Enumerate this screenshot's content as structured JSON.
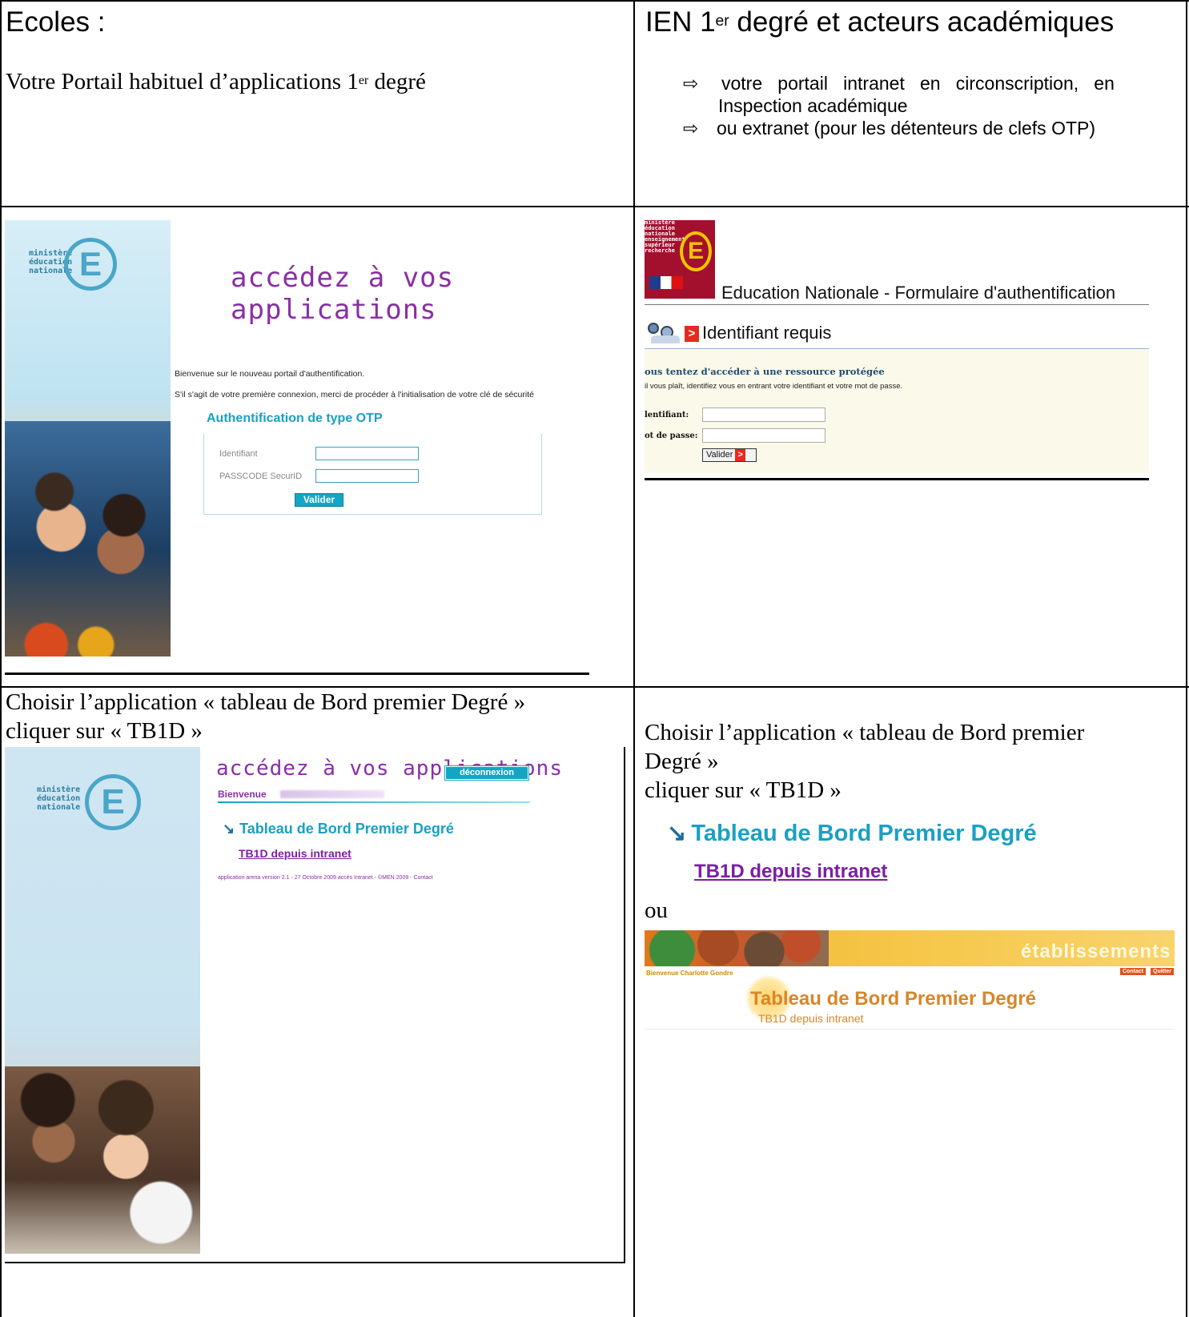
{
  "cells": {
    "top_left": {
      "heading": "Ecoles :",
      "line_prefix": "Votre Portail  habituel d’applications 1",
      "line_sup": "er",
      "line_suffix": " degré"
    },
    "top_right": {
      "heading_prefix": "IEN 1",
      "heading_sup": "er",
      "heading_suffix": " degré et  acteurs académiques",
      "bullet_symbol": "⇨",
      "bullets": [
        "votre   portail   intranet   en   circonscription,   en",
        "Inspection académique",
        "ou extranet (pour les détenteurs de clefs OTP)"
      ]
    },
    "bottom_left": {
      "caption_line1": "Choisir l’application « tableau de Bord premier Degré »",
      "caption_line2": "cliquer sur « TB1D »"
    },
    "bottom_right": {
      "caption_line1": "Choisir l’application « tableau de Bord premier",
      "caption_line2": "Degré »",
      "caption_line3": "cliquer sur « TB1D »",
      "tb_heading": "Tableau de Bord Premier Degré",
      "tb_link": "TB1D depuis intranet",
      "ou": "ou"
    }
  },
  "otp_portal": {
    "logo_lines": [
      "ministère",
      "éducation",
      "nationale"
    ],
    "logo_letter": "E",
    "title": "accédez à vos applications",
    "welcome": "Bienvenue sur le nouveau portail d'authentification.",
    "first_login": "S'il s'agit de votre première connexion, merci de procéder à l'initialisation de votre clé de sécurité",
    "otp_heading": "Authentification de type OTP",
    "id_label": "Identifiant",
    "pass_label": "PASSCODE SecurID",
    "submit": "Valider"
  },
  "auth_form": {
    "logo_lines": [
      "ministère",
      "éducation",
      "nationale",
      "enseignement",
      "supérieur",
      "recherche"
    ],
    "logo_letter": "E",
    "title": "Education Nationale - Formulaire d'authentification",
    "id_required": "Identifiant requis",
    "arrow": ">",
    "protected": "ous tentez d'accéder à une ressource protégée",
    "please": "il vous plaît, identifiez vous en entrant votre identifiant et votre mot de passe.",
    "id_label": "lentifiant:",
    "pass_label": "ot de passe:",
    "submit": "Valider"
  },
  "apps_list": {
    "logo_lines": [
      "ministère",
      "éducation",
      "nationale"
    ],
    "logo_letter": "E",
    "title": "accédez à vos applications",
    "logout": "déconnexion",
    "welcome": "Bienvenue",
    "tb_heading": "Tableau de Bord Premier Degré",
    "tb_link": "TB1D depuis intranet",
    "footer": "application arena version 2.1 - 27 Octobre 2009 accès Intranet - ©MEN 2009 - Contact"
  },
  "etab": {
    "brand": "établissements",
    "welcome": "Bienvenue Charlotte Gondre",
    "contact": "Contact",
    "quit": "Quitter",
    "tb_heading": "Tableau de Bord Premier Degré",
    "tb_sub": "TB1D depuis intranet"
  }
}
